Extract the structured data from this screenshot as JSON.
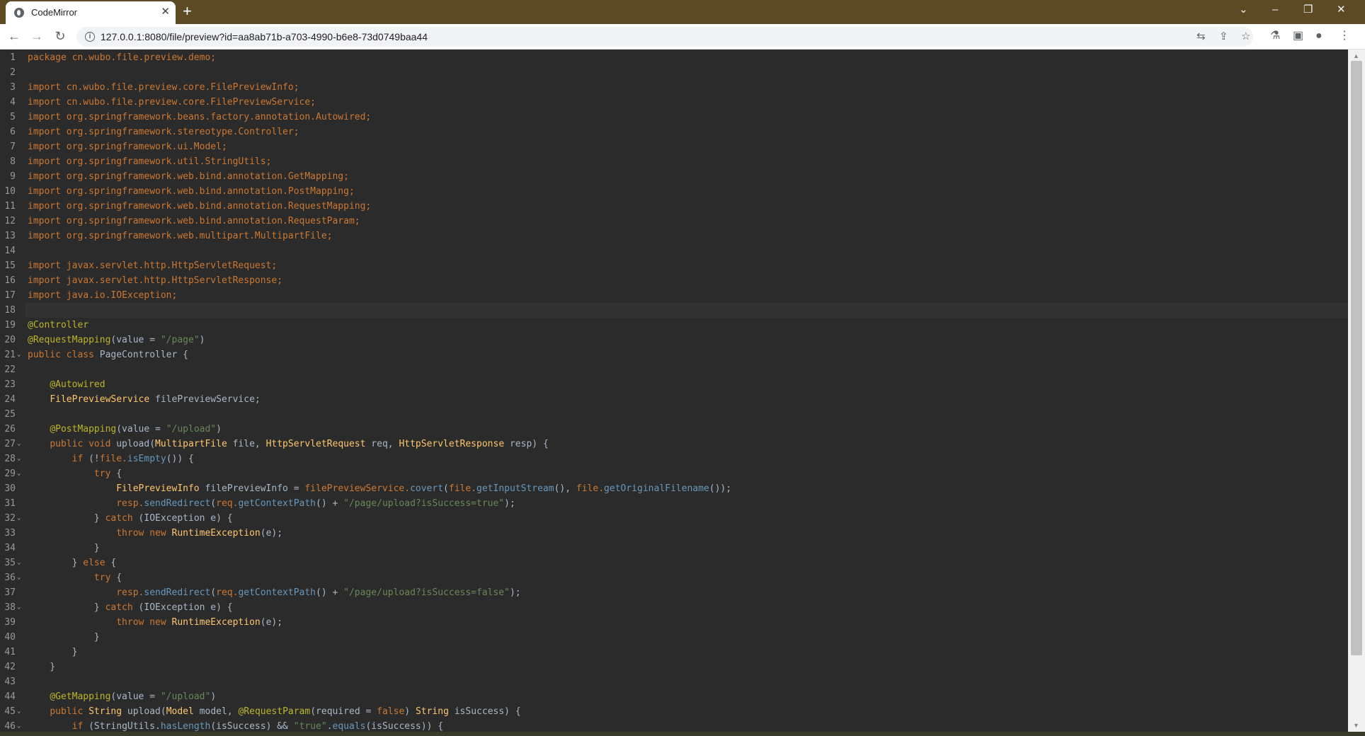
{
  "browser": {
    "tab_title": "CodeMirror",
    "tab_close": "✕",
    "new_tab": "+",
    "url": "127.0.0.1:8080/file/preview?id=aa8ab71b-a703-4990-b6e8-73d0749baa44",
    "window_controls": [
      "⌄",
      "–",
      "❐",
      "✕"
    ]
  },
  "editor": {
    "current_line": 18,
    "lines": [
      [
        [
          "kw",
          "package "
        ],
        [
          "pk",
          "cn.wubo.file.preview.demo;"
        ]
      ],
      [],
      [
        [
          "kw",
          "import "
        ],
        [
          "pk",
          "cn.wubo.file.preview.core.FilePreviewInfo;"
        ]
      ],
      [
        [
          "kw",
          "import "
        ],
        [
          "pk",
          "cn.wubo.file.preview.core.FilePreviewService;"
        ]
      ],
      [
        [
          "kw",
          "import "
        ],
        [
          "pk",
          "org.springframework.beans.factory.annotation.Autowired;"
        ]
      ],
      [
        [
          "kw",
          "import "
        ],
        [
          "pk",
          "org.springframework.stereotype.Controller;"
        ]
      ],
      [
        [
          "kw",
          "import "
        ],
        [
          "pk",
          "org.springframework.ui.Model;"
        ]
      ],
      [
        [
          "kw",
          "import "
        ],
        [
          "pk",
          "org.springframework.util.StringUtils;"
        ]
      ],
      [
        [
          "kw",
          "import "
        ],
        [
          "pk",
          "org.springframework.web.bind.annotation.GetMapping;"
        ]
      ],
      [
        [
          "kw",
          "import "
        ],
        [
          "pk",
          "org.springframework.web.bind.annotation.PostMapping;"
        ]
      ],
      [
        [
          "kw",
          "import "
        ],
        [
          "pk",
          "org.springframework.web.bind.annotation.RequestMapping;"
        ]
      ],
      [
        [
          "kw",
          "import "
        ],
        [
          "pk",
          "org.springframework.web.bind.annotation.RequestParam;"
        ]
      ],
      [
        [
          "kw",
          "import "
        ],
        [
          "pk",
          "org.springframework.web.multipart.MultipartFile;"
        ]
      ],
      [],
      [
        [
          "kw",
          "import "
        ],
        [
          "pk",
          "javax.servlet.http.HttpServletRequest;"
        ]
      ],
      [
        [
          "kw",
          "import "
        ],
        [
          "pk",
          "javax.servlet.http.HttpServletResponse;"
        ]
      ],
      [
        [
          "kw",
          "import "
        ],
        [
          "pk",
          "java.io.IOException;"
        ]
      ],
      [],
      [
        [
          "ann",
          "@Controller"
        ]
      ],
      [
        [
          "ann",
          "@RequestMapping"
        ],
        [
          "",
          "(value = "
        ],
        [
          "str",
          "\"/page\""
        ],
        [
          "",
          ")"
        ]
      ],
      [
        [
          "kw",
          "public class "
        ],
        [
          "",
          "PageController {"
        ]
      ],
      [],
      [
        [
          "",
          "    "
        ],
        [
          "ann",
          "@Autowired"
        ]
      ],
      [
        [
          "",
          "    "
        ],
        [
          "typ",
          "FilePreviewService "
        ],
        [
          "",
          "filePreviewService;"
        ]
      ],
      [],
      [
        [
          "",
          "    "
        ],
        [
          "ann",
          "@PostMapping"
        ],
        [
          "",
          "(value = "
        ],
        [
          "str",
          "\"/upload\""
        ],
        [
          "",
          ")"
        ]
      ],
      [
        [
          "",
          "    "
        ],
        [
          "kw",
          "public void "
        ],
        [
          "",
          "upload("
        ],
        [
          "typ",
          "MultipartFile "
        ],
        [
          "",
          "file, "
        ],
        [
          "typ",
          "HttpServletRequest "
        ],
        [
          "",
          "req, "
        ],
        [
          "typ",
          "HttpServletResponse "
        ],
        [
          "",
          "resp) {"
        ]
      ],
      [
        [
          "",
          "        "
        ],
        [
          "kw",
          "if "
        ],
        [
          "",
          "(!"
        ],
        [
          "pk",
          "file."
        ],
        [
          "fn",
          "isEmpty"
        ],
        [
          "",
          "()) {"
        ]
      ],
      [
        [
          "",
          "            "
        ],
        [
          "kw",
          "try "
        ],
        [
          "",
          "{"
        ]
      ],
      [
        [
          "",
          "                "
        ],
        [
          "typ",
          "FilePreviewInfo "
        ],
        [
          "",
          "filePreviewInfo = "
        ],
        [
          "pk",
          "filePreviewService."
        ],
        [
          "fn",
          "covert"
        ],
        [
          "",
          "("
        ],
        [
          "pk",
          "file."
        ],
        [
          "fn",
          "getInputStream"
        ],
        [
          "",
          "(), "
        ],
        [
          "pk",
          "file."
        ],
        [
          "fn",
          "getOriginalFilename"
        ],
        [
          "",
          "());"
        ]
      ],
      [
        [
          "",
          "                "
        ],
        [
          "pk",
          "resp."
        ],
        [
          "fn",
          "sendRedirect"
        ],
        [
          "",
          "("
        ],
        [
          "pk",
          "req."
        ],
        [
          "fn",
          "getContextPath"
        ],
        [
          "",
          "() + "
        ],
        [
          "str",
          "\"/page/upload?isSuccess=true\""
        ],
        [
          "",
          ");"
        ]
      ],
      [
        [
          "",
          "            } "
        ],
        [
          "kw",
          "catch "
        ],
        [
          "",
          "(IOException e) {"
        ]
      ],
      [
        [
          "",
          "                "
        ],
        [
          "kw",
          "throw new "
        ],
        [
          "typ",
          "RuntimeException"
        ],
        [
          "",
          "(e);"
        ]
      ],
      [
        [
          "",
          "            }"
        ]
      ],
      [
        [
          "",
          "        } "
        ],
        [
          "kw",
          "else "
        ],
        [
          "",
          "{"
        ]
      ],
      [
        [
          "",
          "            "
        ],
        [
          "kw",
          "try "
        ],
        [
          "",
          "{"
        ]
      ],
      [
        [
          "",
          "                "
        ],
        [
          "pk",
          "resp."
        ],
        [
          "fn",
          "sendRedirect"
        ],
        [
          "",
          "("
        ],
        [
          "pk",
          "req."
        ],
        [
          "fn",
          "getContextPath"
        ],
        [
          "",
          "() + "
        ],
        [
          "str",
          "\"/page/upload?isSuccess=false\""
        ],
        [
          "",
          ");"
        ]
      ],
      [
        [
          "",
          "            } "
        ],
        [
          "kw",
          "catch "
        ],
        [
          "",
          "(IOException e) {"
        ]
      ],
      [
        [
          "",
          "                "
        ],
        [
          "kw",
          "throw new "
        ],
        [
          "typ",
          "RuntimeException"
        ],
        [
          "",
          "(e);"
        ]
      ],
      [
        [
          "",
          "            }"
        ]
      ],
      [
        [
          "",
          "        }"
        ]
      ],
      [
        [
          "",
          "    }"
        ]
      ],
      [],
      [
        [
          "",
          "    "
        ],
        [
          "ann",
          "@GetMapping"
        ],
        [
          "",
          "(value = "
        ],
        [
          "str",
          "\"/upload\""
        ],
        [
          "",
          ")"
        ]
      ],
      [
        [
          "",
          "    "
        ],
        [
          "kw",
          "public "
        ],
        [
          "typ",
          "String "
        ],
        [
          "",
          "upload("
        ],
        [
          "typ",
          "Model "
        ],
        [
          "",
          "model, "
        ],
        [
          "ann",
          "@RequestParam"
        ],
        [
          "",
          "(required = "
        ],
        [
          "kw",
          "false"
        ],
        [
          "",
          ") "
        ],
        [
          "typ",
          "String "
        ],
        [
          "",
          "isSuccess) {"
        ]
      ],
      [
        [
          "",
          "        "
        ],
        [
          "kw",
          "if "
        ],
        [
          "",
          "(StringUtils."
        ],
        [
          "fn",
          "hasLength"
        ],
        [
          "",
          "(isSuccess) && "
        ],
        [
          "str",
          "\"true\""
        ],
        [
          "",
          "."
        ],
        [
          "fn",
          "equals"
        ],
        [
          "",
          "(isSuccess)) {"
        ]
      ]
    ],
    "fold_lines": [
      21,
      27,
      28,
      29,
      32,
      35,
      36,
      38,
      45,
      46
    ]
  }
}
